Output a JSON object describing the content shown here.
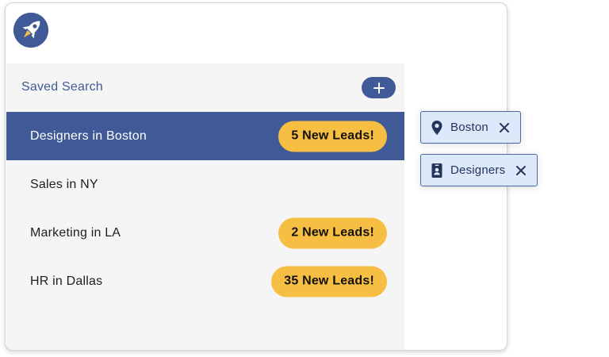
{
  "app": {
    "logo_icon": "rocket-icon",
    "brand_color": "#3f5a96"
  },
  "saved_search": {
    "title": "Saved Search",
    "add_icon": "plus-icon",
    "items": [
      {
        "label": "Designers in Boston",
        "badge": "5 New Leads!",
        "selected": true
      },
      {
        "label": "Sales in NY",
        "badge": "",
        "selected": false
      },
      {
        "label": "Marketing in LA",
        "badge": "2 New Leads!",
        "selected": false
      },
      {
        "label": "HR in Dallas",
        "badge": "35 New Leads!",
        "selected": false
      }
    ]
  },
  "filters": [
    {
      "label": "Boston",
      "icon": "map-pin-icon",
      "remove_icon": "close-icon"
    },
    {
      "label": "Designers",
      "icon": "id-badge-icon",
      "remove_icon": "close-icon"
    }
  ],
  "colors": {
    "accent": "#3f5a96",
    "badge": "#f6bf43",
    "chip_bg": "#dbe9fb",
    "panel_bg": "#f5f5f5"
  }
}
